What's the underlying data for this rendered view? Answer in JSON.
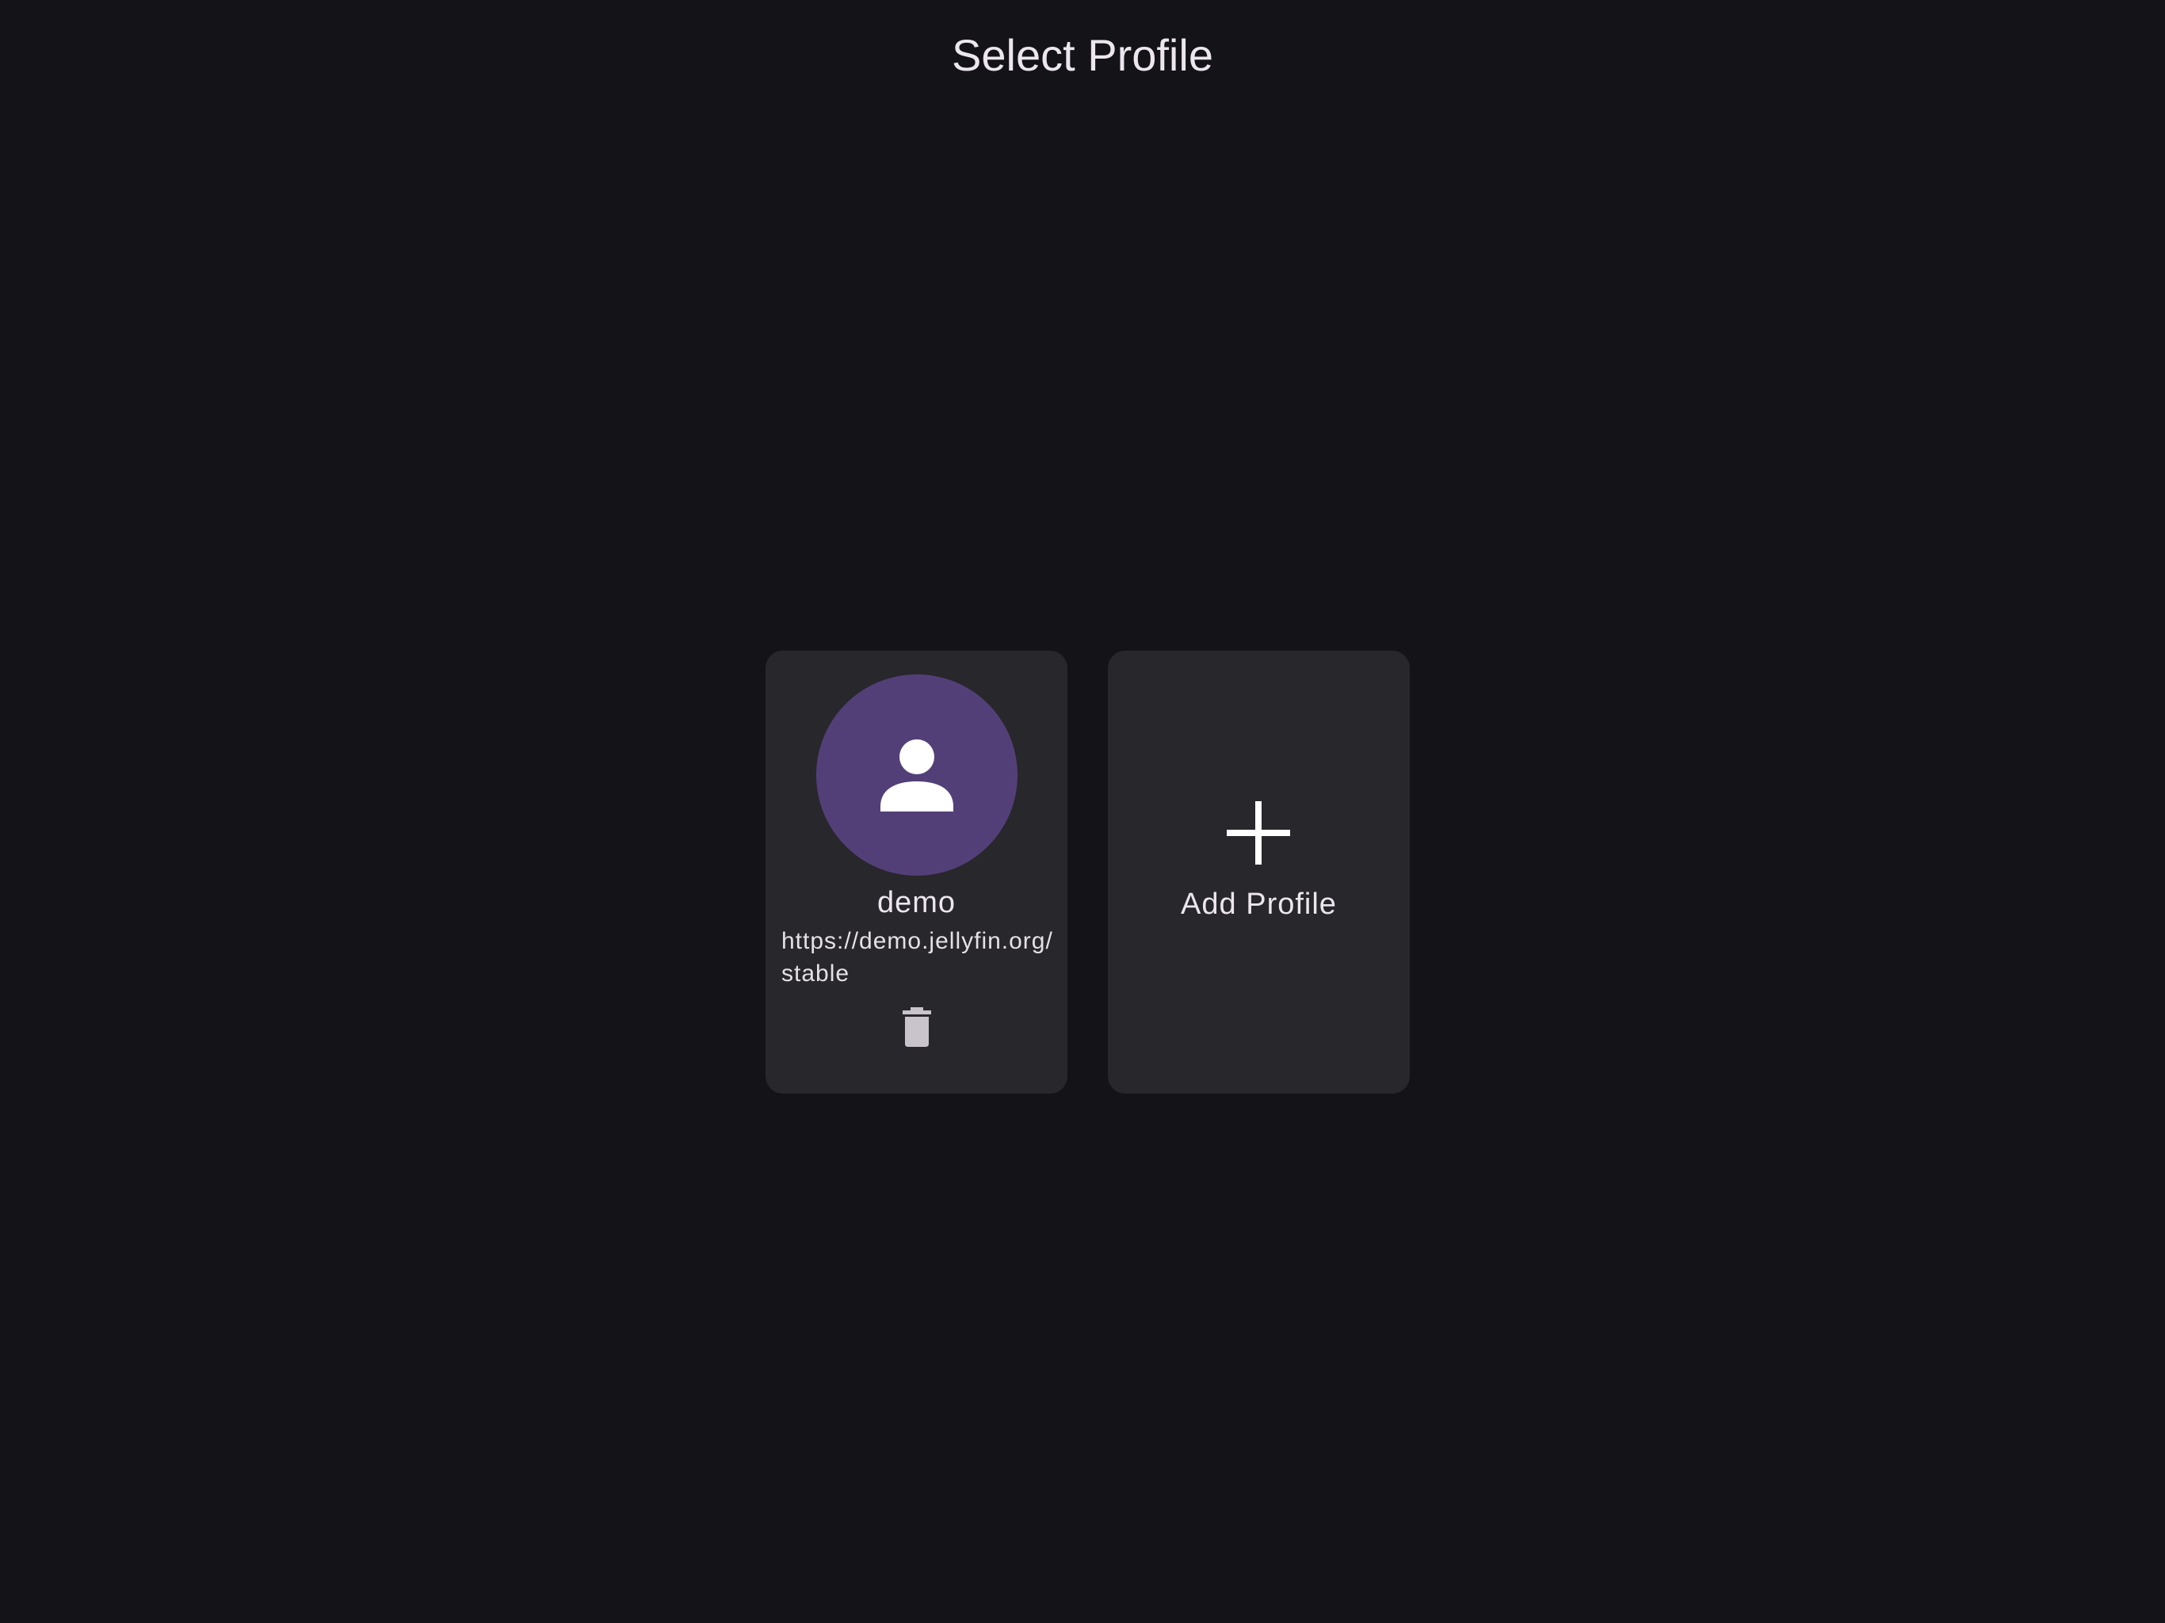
{
  "header": {
    "title": "Select Profile"
  },
  "profiles": [
    {
      "name": "demo",
      "url": "https://demo.jellyfin.org/stable",
      "avatar_icon": "person-icon",
      "delete_icon": "trash-icon"
    }
  ],
  "add_profile": {
    "label": "Add Profile",
    "icon": "plus-icon"
  },
  "colors": {
    "background": "#141318",
    "card": "#28272c",
    "avatar": "#533f78",
    "text": "#ece6ee",
    "delete_icon": "#c9c3cc"
  }
}
